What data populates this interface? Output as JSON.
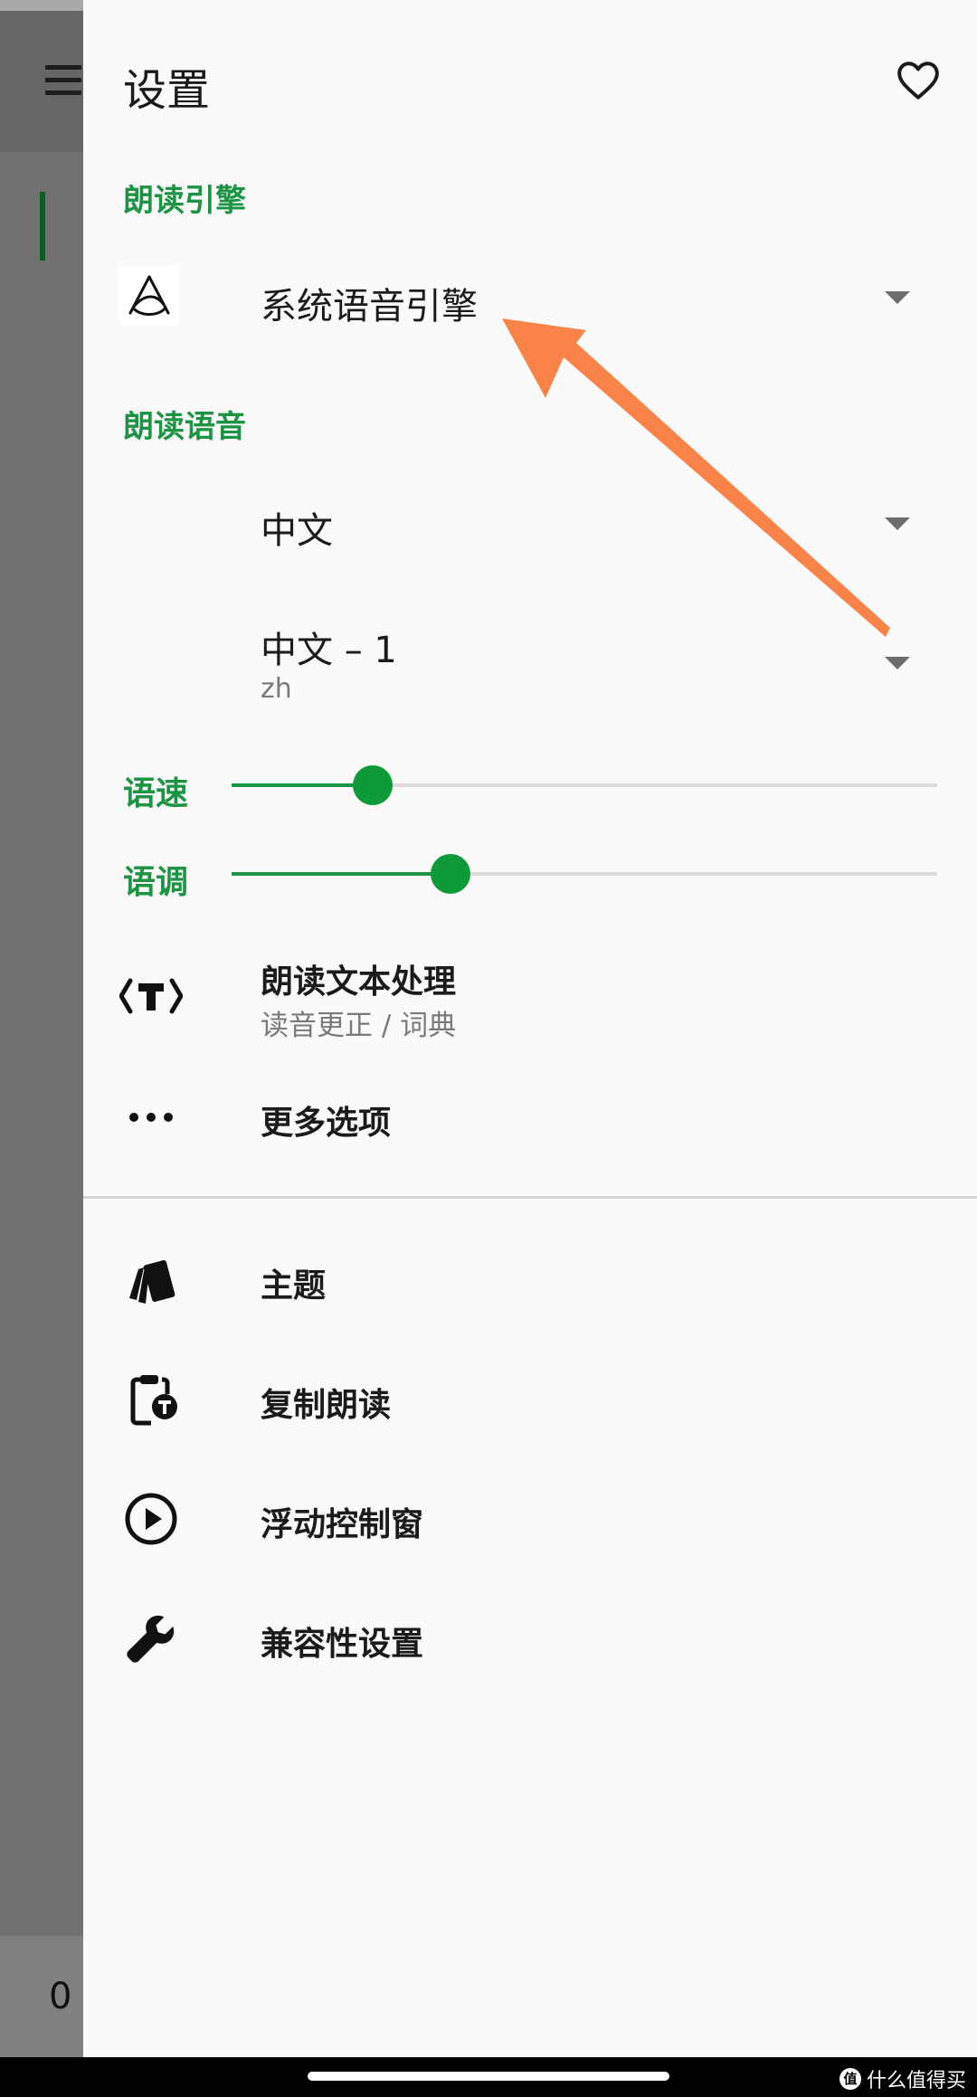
{
  "drawer": {
    "title": "设置",
    "favorite_icon": "heart-outline-icon"
  },
  "engine_section": {
    "heading": "朗读引擎",
    "engine_value": "系统语音引擎",
    "engine_icon": "engine-logo-icon"
  },
  "voice_section": {
    "heading": "朗读语音",
    "language_value": "中文",
    "voice_value": "中文 – 1",
    "voice_sub": "zh"
  },
  "sliders": {
    "rate_label": "语速",
    "rate_level": 0.2,
    "pitch_label": "语调",
    "pitch_level": 0.31
  },
  "options": {
    "text_processing_label": "朗读文本处理",
    "text_processing_sub": "读音更正 / 词典",
    "more_label": "更多选项"
  },
  "menu": {
    "theme_label": "主题",
    "copy_read_label": "复制朗读",
    "floating_window_label": "浮动控制窗",
    "compat_label": "兼容性设置"
  },
  "background": {
    "partial_value": "0"
  },
  "watermark": {
    "logo_glyph": "值",
    "text": "什么值得买"
  },
  "colors": {
    "accent": "#1d9444",
    "annotation_arrow": "#f98349"
  }
}
